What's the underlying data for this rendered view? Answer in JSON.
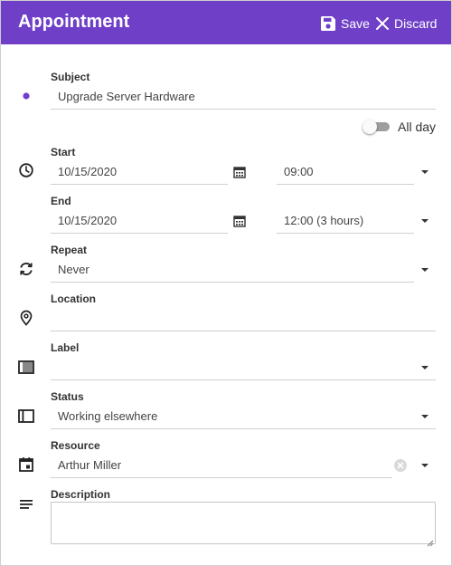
{
  "header": {
    "title": "Appointment",
    "save_label": "Save",
    "discard_label": "Discard"
  },
  "colors": {
    "accent": "#6f40c7",
    "label_dot": "#6f40c7"
  },
  "subject": {
    "label": "Subject",
    "value": "Upgrade Server Hardware"
  },
  "all_day": {
    "label": "All day",
    "checked": false
  },
  "start": {
    "label": "Start",
    "date": "10/15/2020",
    "time": "09:00"
  },
  "end": {
    "label": "End",
    "date": "10/15/2020",
    "time": "12:00 (3 hours)"
  },
  "repeat": {
    "label": "Repeat",
    "value": "Never"
  },
  "location": {
    "label": "Location",
    "value": ""
  },
  "label_field": {
    "label": "Label",
    "value": ""
  },
  "status": {
    "label": "Status",
    "value": "Working elsewhere"
  },
  "resource": {
    "label": "Resource",
    "value": "Arthur Miller"
  },
  "description": {
    "label": "Description",
    "value": ""
  },
  "icons": {
    "save": "floppy-disk-icon",
    "discard": "close-icon",
    "subject": "dot-icon",
    "time": "clock-icon",
    "repeat": "refresh-icon",
    "location": "map-pin-icon",
    "label": "label-swatch-icon",
    "status": "status-panel-icon",
    "resource": "calendar-icon",
    "description": "lines-icon",
    "date_picker": "calendar-icon",
    "dropdown": "chevron-down-icon"
  }
}
